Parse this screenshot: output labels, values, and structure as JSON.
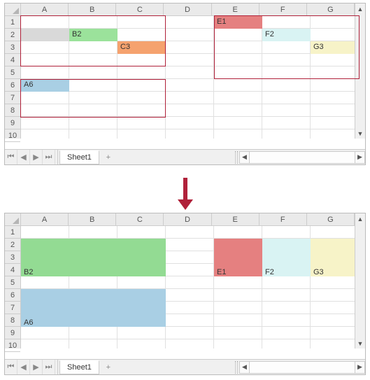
{
  "columns": [
    "A",
    "B",
    "C",
    "D",
    "E",
    "F",
    "G"
  ],
  "top": {
    "rowCount": 10,
    "cells": {
      "A2": {
        "text": "",
        "bg": "#d9d9d9"
      },
      "B2": {
        "text": "B2",
        "bg": "#9be29b"
      },
      "C3": {
        "text": "C3",
        "bg": "#f5a26e"
      },
      "E1": {
        "text": "E1",
        "bg": "#e58080"
      },
      "F2": {
        "text": "F2",
        "bg": "#d9f3f3"
      },
      "G3": {
        "text": "G3",
        "bg": "#f7f3c8"
      },
      "A6": {
        "text": "A6",
        "bg": "#a9cfe4"
      }
    }
  },
  "bottom": {
    "rowCount": 10,
    "cells": {
      "B2": {
        "text": "B2",
        "bg": "#93db93",
        "span": "A2:C4"
      },
      "E1": {
        "text": "E1",
        "bg": "#e58080",
        "span": "E2:E4"
      },
      "F2": {
        "text": "F2",
        "bg": "#d9f3f3",
        "span": "F2:F4"
      },
      "G3": {
        "text": "G3",
        "bg": "#f7f3c8",
        "span": "G2:G4"
      },
      "A6": {
        "text": "A6",
        "bg": "#a9cfe4",
        "span": "A6:C8"
      }
    }
  },
  "sheet": {
    "name": "Sheet1",
    "add": "+"
  },
  "nav": {
    "first": "⏮",
    "prev": "◀",
    "next": "▶",
    "last": "⏭"
  },
  "scroll": {
    "up": "▲",
    "down": "▼",
    "left": "◀",
    "right": "▶"
  }
}
